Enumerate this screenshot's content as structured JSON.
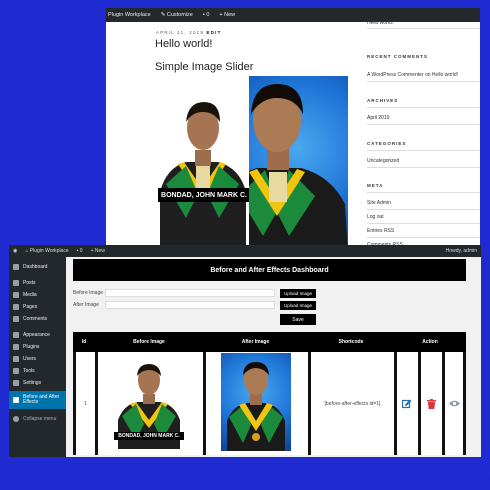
{
  "frontend": {
    "admin_bar": {
      "site_name": "Plugin Workplace",
      "customize": "Customize",
      "comments_count": "0",
      "new_label": "New"
    },
    "post_date": "APRIL 11, 2019",
    "edit_label": "EDIT",
    "post_title": "Hello world!",
    "slider_title": "Simple Image Slider",
    "slider_caption": "BONDAD, JOHN MARK C.",
    "sidebar": {
      "recent_post": "Hello world!",
      "recent_comments_heading": "RECENT COMMENTS",
      "recent_comment": "A WordPress Commenter on Hello world!",
      "archives_heading": "ARCHIVES",
      "archive_item": "April 2019",
      "categories_heading": "CATEGORIES",
      "category_item": "Uncategorized",
      "meta_heading": "META",
      "meta_items": [
        "Site Admin",
        "Log out",
        "Entries RSS",
        "Comments RSS"
      ]
    }
  },
  "admin": {
    "admin_bar": {
      "site_name": "Plugin Workplace",
      "comments_count": "0",
      "new_label": "New",
      "howdy": "Howdy, admin"
    },
    "menu": [
      {
        "label": "Dashboard",
        "icon": "dashboard-icon"
      },
      {
        "label": "Posts",
        "icon": "pin-icon"
      },
      {
        "label": "Media",
        "icon": "media-icon"
      },
      {
        "label": "Pages",
        "icon": "page-icon"
      },
      {
        "label": "Comments",
        "icon": "comment-icon"
      },
      {
        "label": "Appearance",
        "icon": "brush-icon"
      },
      {
        "label": "Plugins",
        "icon": "plug-icon"
      },
      {
        "label": "Users",
        "icon": "user-icon"
      },
      {
        "label": "Tools",
        "icon": "wrench-icon"
      },
      {
        "label": "Settings",
        "icon": "settings-icon"
      }
    ],
    "active_menu": {
      "label_line1": "Before and After",
      "label_line2": "Effects"
    },
    "collapse_label": "Collapse menu",
    "dashboard_title": "Before and After Effects Dashboard",
    "form": {
      "before_label": "Before Image",
      "after_label": "After Image",
      "upload_label": "Upload Image",
      "save_label": "Save"
    },
    "table": {
      "headers": [
        "Id",
        "Before Image",
        "After Image",
        "Shortcode",
        "",
        "Action",
        ""
      ],
      "row": {
        "id": "1",
        "before_caption": "BONDAD, JOHN MARK C.",
        "shortcode": "[before-after-effects id=1]"
      }
    }
  },
  "colors": {
    "background": "#1f2bd0",
    "admin_bar": "#23282d",
    "active_menu": "#0073aa",
    "edit_action": "#2271b1",
    "delete_action": "#d63638",
    "view_action": "#8c9aa5"
  }
}
